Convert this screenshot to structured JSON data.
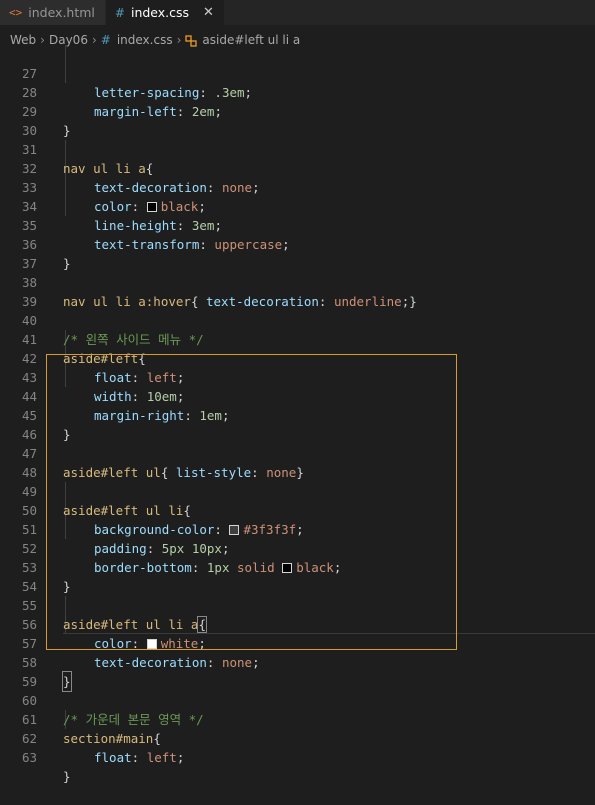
{
  "tabs": [
    {
      "icon": "html-icon",
      "label": "index.html",
      "active": false
    },
    {
      "icon": "css-icon",
      "label": "index.css",
      "active": true,
      "close": "✕"
    }
  ],
  "breadcrumb": {
    "items": [
      "Web",
      "Day06",
      "index.css",
      "aside#left ul li a"
    ]
  },
  "lines": [
    {
      "n": "27",
      "code": "letter-spacing: .3em;"
    },
    {
      "n": "28",
      "code": "margin-left: 2em;"
    },
    {
      "n": "29",
      "code": "}"
    },
    {
      "n": "30",
      "code": ""
    },
    {
      "n": "31",
      "code": "nav ul li a{"
    },
    {
      "n": "32",
      "code": "text-decoration: none;"
    },
    {
      "n": "33",
      "code": "color: black;"
    },
    {
      "n": "34",
      "code": "line-height: 3em;"
    },
    {
      "n": "35",
      "code": "text-transform: uppercase;"
    },
    {
      "n": "36",
      "code": "}"
    },
    {
      "n": "37",
      "code": ""
    },
    {
      "n": "38",
      "code": "nav ul li a:hover{ text-decoration: underline;}"
    },
    {
      "n": "39",
      "code": ""
    },
    {
      "n": "40",
      "code": "/* 왼쪽 사이드 메뉴 */"
    },
    {
      "n": "41",
      "code": "aside#left{"
    },
    {
      "n": "42",
      "code": "float: left;"
    },
    {
      "n": "43",
      "code": "width: 10em;"
    },
    {
      "n": "44",
      "code": "margin-right: 1em;"
    },
    {
      "n": "45",
      "code": "}"
    },
    {
      "n": "46",
      "code": ""
    },
    {
      "n": "47",
      "code": "aside#left ul{ list-style: none}"
    },
    {
      "n": "48",
      "code": ""
    },
    {
      "n": "49",
      "code": "aside#left ul li{"
    },
    {
      "n": "50",
      "code": "background-color: #3f3f3f;"
    },
    {
      "n": "51",
      "code": "padding: 5px 10px;"
    },
    {
      "n": "52",
      "code": "border-bottom: 1px solid black;"
    },
    {
      "n": "53",
      "code": "}"
    },
    {
      "n": "54",
      "code": ""
    },
    {
      "n": "55",
      "code": "aside#left ul li a{"
    },
    {
      "n": "56",
      "code": "color: white;"
    },
    {
      "n": "57",
      "code": "text-decoration: none;"
    },
    {
      "n": "58",
      "code": "}"
    },
    {
      "n": "59",
      "code": ""
    },
    {
      "n": "60",
      "code": "/* 가운데 본문 영역 */"
    },
    {
      "n": "61",
      "code": "section#main{"
    },
    {
      "n": "62",
      "code": "float: left;"
    },
    {
      "n": "63",
      "code": "}"
    }
  ],
  "swatches": {
    "black": "#000000",
    "gray": "#3f3f3f",
    "white": "#ffffff"
  },
  "colors": {
    "selector": "#d7ba7d",
    "property": "#9cdcfe",
    "value": "#ce9178",
    "number": "#b5cea8",
    "comment": "#6a9955",
    "highlight_border": "#d79b2a"
  }
}
